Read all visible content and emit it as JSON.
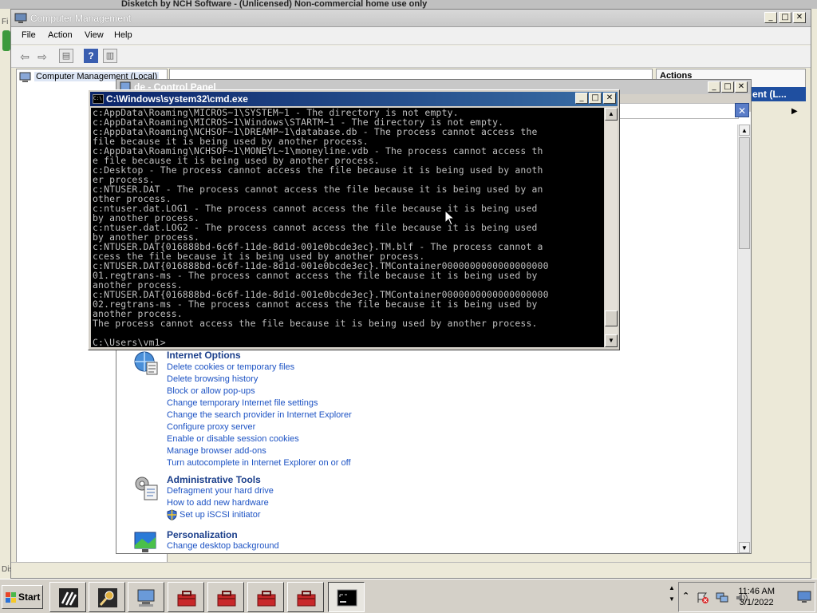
{
  "disketch": {
    "title": "Disketch by NCH Software - (Unlicensed) Non-commercial home use only",
    "left_labels": [
      "Fi",
      "Dis"
    ]
  },
  "computer_management": {
    "title": "Computer Management",
    "menu": [
      "File",
      "Action",
      "View",
      "Help"
    ],
    "tree_root": "Computer Management (Local)",
    "actions_header": "Actions",
    "actions_item": "ent (L..."
  },
  "control_panel": {
    "title": "de - Control Panel",
    "sections": [
      {
        "icon": "internet-options-icon",
        "title": "Internet Options",
        "links": [
          "Delete cookies or temporary files",
          "Delete browsing history",
          "Block or allow pop-ups",
          "Change temporary Internet file settings",
          "Change the search provider in Internet Explorer",
          "Configure proxy server",
          "Enable or disable session cookies",
          "Manage browser add-ons",
          "Turn autocomplete in Internet Explorer on or off"
        ]
      },
      {
        "icon": "administrative-tools-icon",
        "title": "Administrative Tools",
        "links": [
          "Defragment your hard drive",
          "How to add new hardware",
          "Set up iSCSI initiator"
        ]
      },
      {
        "icon": "personalization-icon",
        "title": "Personalization",
        "links": [
          "Change desktop background"
        ]
      }
    ]
  },
  "cmd": {
    "title": "C:\\Windows\\system32\\cmd.exe",
    "icon_text": "C:\\",
    "lines": [
      "c:AppData\\Roaming\\MICROS~1\\SYSTEM~1 - The directory is not empty.",
      "c:AppData\\Roaming\\MICROS~1\\Windows\\STARTM~1 - The directory is not empty.",
      "c:AppData\\Roaming\\NCHSOF~1\\DREAMP~1\\database.db - The process cannot access the",
      "file because it is being used by another process.",
      "c:AppData\\Roaming\\NCHSOF~1\\MONEYL~1\\moneyline.vdb - The process cannot access th",
      "e file because it is being used by another process.",
      "c:Desktop - The process cannot access the file because it is being used by anoth",
      "er process.",
      "c:NTUSER.DAT - The process cannot access the file because it is being used by an",
      "other process.",
      "c:ntuser.dat.LOG1 - The process cannot access the file because it is being used",
      "by another process.",
      "c:ntuser.dat.LOG2 - The process cannot access the file because it is being used",
      "by another process.",
      "c:NTUSER.DAT{016888bd-6c6f-11de-8d1d-001e0bcde3ec}.TM.blf - The process cannot a",
      "ccess the file because it is being used by another process.",
      "c:NTUSER.DAT{016888bd-6c6f-11de-8d1d-001e0bcde3ec}.TMContainer0000000000000000000",
      "01.regtrans-ms - The process cannot access the file because it is being used by",
      "another process.",
      "c:NTUSER.DAT{016888bd-6c6f-11de-8d1d-001e0bcde3ec}.TMContainer0000000000000000000",
      "02.regtrans-ms - The process cannot access the file because it is being used by",
      "another process.",
      "The process cannot access the file because it is being used by another process.",
      "",
      "C:\\Users\\vm1>"
    ]
  },
  "taskbar": {
    "start_label": "Start",
    "items": [
      "task-manager-icon",
      "search-icon",
      "computer-management-icon",
      "toolbox-icon-1",
      "toolbox-icon-2",
      "toolbox-icon-3",
      "toolbox-icon-4",
      "cmd-icon"
    ],
    "time": "11:46 AM",
    "date": "3/1/2022"
  }
}
